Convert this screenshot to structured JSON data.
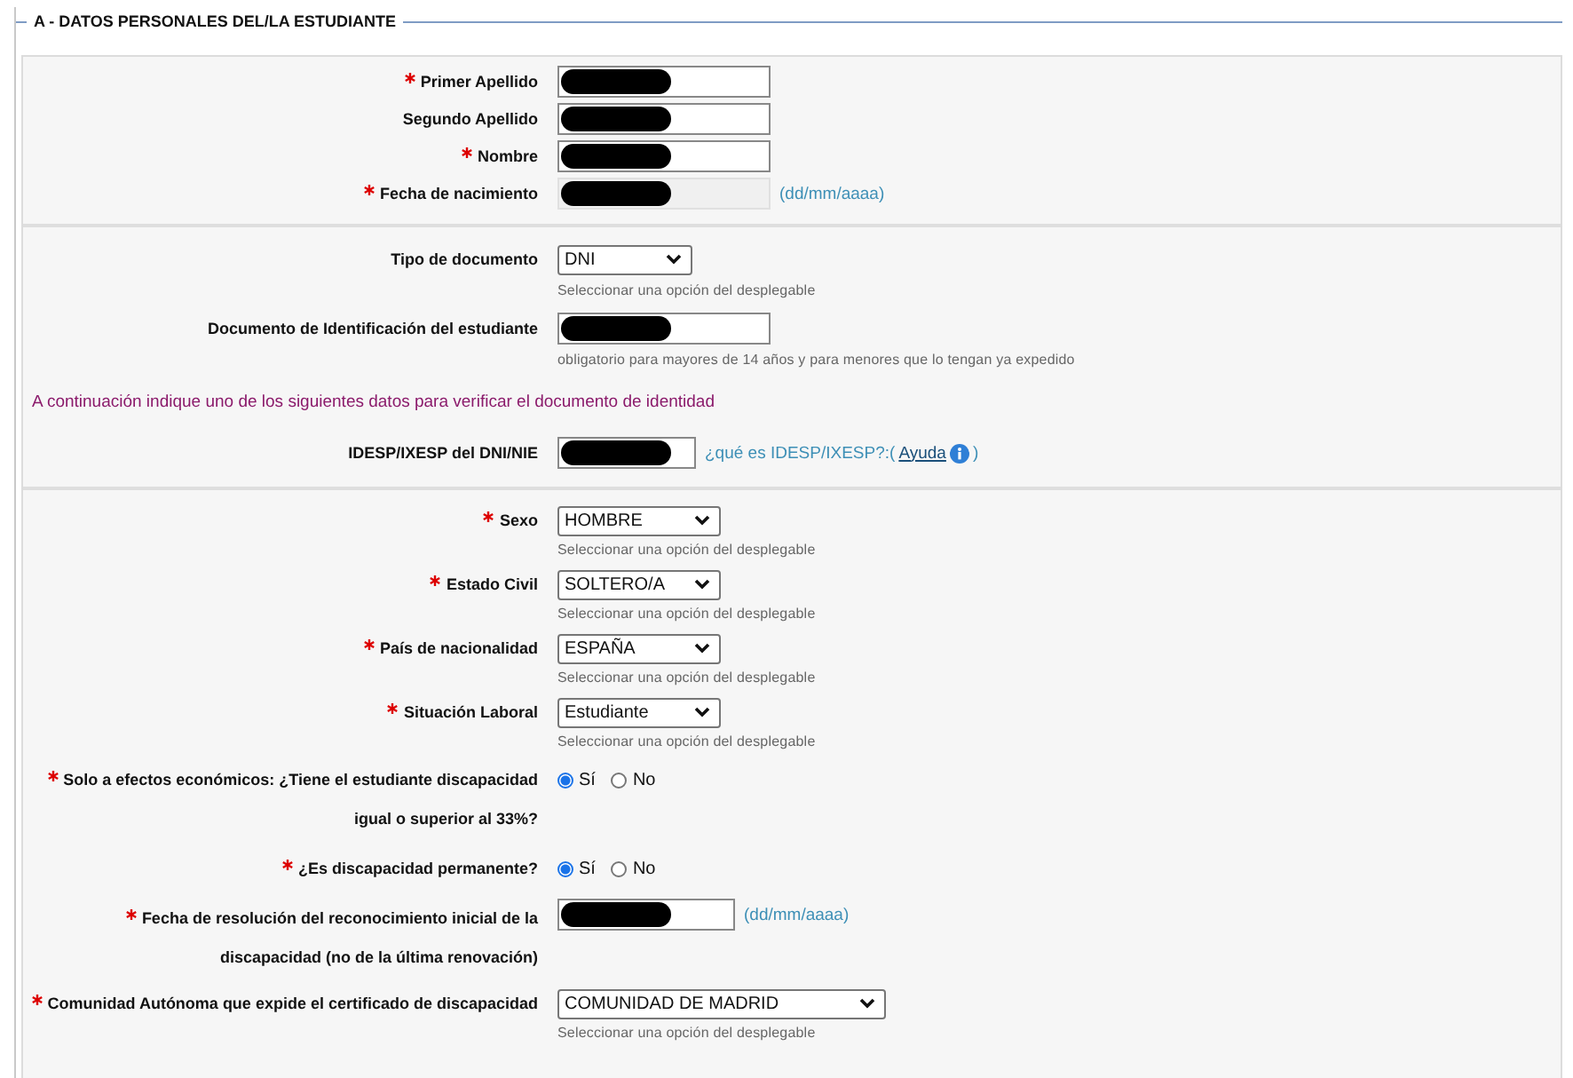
{
  "legend": "A - DATOS PERSONALES DEL/LA ESTUDIANTE",
  "sections": [
    {
      "rows": [
        {
          "kind": "text",
          "label": "Primer Apellido",
          "required": true,
          "redacted": true
        },
        {
          "kind": "text",
          "label": "Segundo Apellido",
          "required": false,
          "redacted": true
        },
        {
          "kind": "text",
          "label": "Nombre",
          "required": true,
          "redacted": true
        },
        {
          "kind": "date",
          "label": "Fecha de nacimiento",
          "required": true,
          "redacted": true,
          "disabled": true,
          "hint": "(dd/mm/aaaa)"
        }
      ]
    },
    {
      "rows": [
        {
          "kind": "select",
          "label": "Tipo de documento",
          "required": false,
          "value": "DNI",
          "help": "Seleccionar una opción del desplegable"
        },
        {
          "kind": "text",
          "label": "Documento de Identificación del estudiante",
          "required": false,
          "redacted": true,
          "help": "obligatorio para mayores de 14 años y para menores que lo tengan ya expedido"
        },
        {
          "kind": "notice",
          "text": "A continuación indique uno de los siguientes datos para verificar el documento de identidad"
        },
        {
          "kind": "text",
          "label": "IDESP/IXESP del DNI/NIE",
          "required": false,
          "redacted": true,
          "link_prefix": "¿qué es IDESP/IXESP?:(",
          "link": "Ayuda",
          "link_suffix": ")"
        }
      ]
    },
    {
      "rows": [
        {
          "kind": "select",
          "label": "Sexo",
          "required": true,
          "value": "HOMBRE",
          "help": "Seleccionar una opción del desplegable"
        },
        {
          "kind": "select",
          "label": "Estado Civil",
          "required": true,
          "value": "SOLTERO/A",
          "help": "Seleccionar una opción del desplegable"
        },
        {
          "kind": "select",
          "label": "País de nacionalidad",
          "required": true,
          "value": "ESPAÑA",
          "help": "Seleccionar una opción del desplegable"
        },
        {
          "kind": "select",
          "label": "Situación Laboral",
          "required": true,
          "value": "Estudiante",
          "help": "Seleccionar una opción del desplegable"
        },
        {
          "kind": "radio",
          "label": "Solo a efectos económicos: ¿Tiene el estudiante discapacidad igual o superior al 33%?",
          "required": true,
          "options": [
            {
              "label": "Sí",
              "selected": true
            },
            {
              "label": "No",
              "selected": false
            }
          ]
        },
        {
          "kind": "radio",
          "label": "¿Es discapacidad permanente?",
          "required": true,
          "options": [
            {
              "label": "Sí",
              "selected": true
            },
            {
              "label": "No",
              "selected": false
            }
          ]
        },
        {
          "kind": "date",
          "label": "Fecha de resolución del reconocimiento inicial de la discapacidad (no de la última renovación)",
          "required": true,
          "redacted": true,
          "disabled": false,
          "hint": "(dd/mm/aaaa)"
        },
        {
          "kind": "select",
          "label": "Comunidad Autónoma que expide el certificado de discapacidad",
          "required": true,
          "value": "COMUNIDAD DE MADRID",
          "help": "Seleccionar una opción del desplegable"
        }
      ]
    }
  ]
}
